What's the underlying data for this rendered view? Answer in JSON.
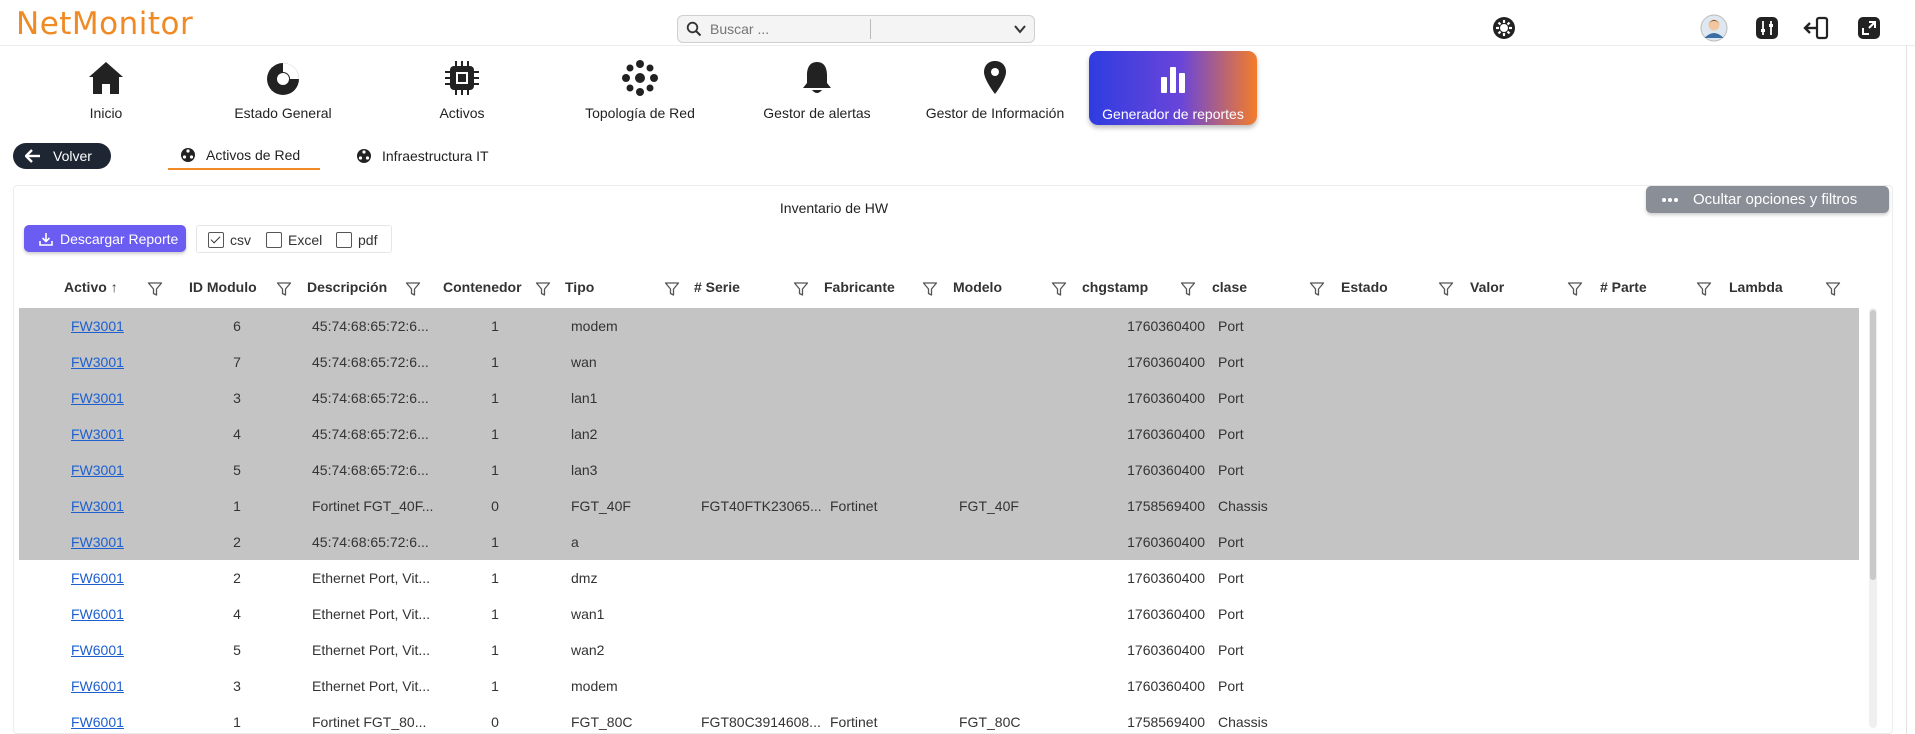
{
  "app": {
    "logo": "NetMonitor"
  },
  "search": {
    "placeholder": "Buscar ..."
  },
  "nav": [
    {
      "label": "Inicio",
      "icon": "home-icon"
    },
    {
      "label": "Estado General",
      "icon": "gauge-icon"
    },
    {
      "label": "Activos",
      "icon": "chip-icon"
    },
    {
      "label": "Topología de Red",
      "icon": "network-icon"
    },
    {
      "label": "Gestor de alertas",
      "icon": "bell-icon"
    },
    {
      "label": "Gestor de Información",
      "icon": "map-pin-icon"
    },
    {
      "label": "Generador de reportes",
      "icon": "bar-chart-icon",
      "active": true
    }
  ],
  "back": {
    "label": "Volver"
  },
  "subtabs": [
    {
      "label": "Activos de Red",
      "active": true
    },
    {
      "label": "Infraestructura IT",
      "active": false
    }
  ],
  "panel": {
    "title": "Inventario de HW",
    "toggle_label": "Ocultar opciones y filtros",
    "download_label": "Descargar Reporte",
    "formats": [
      {
        "label": "csv",
        "checked": true
      },
      {
        "label": "Excel",
        "checked": false
      },
      {
        "label": "pdf",
        "checked": false
      }
    ]
  },
  "table": {
    "columns": [
      "Activo",
      "ID Modulo",
      "Descripción",
      "Contenedor",
      "Tipo",
      "# Serie",
      "Fabricante",
      "Modelo",
      "chgstamp",
      "clase",
      "Estado",
      "Valor",
      "# Parte",
      "Lambda"
    ],
    "sort_indicator": "↑",
    "rows": [
      {
        "activo": "FW3001",
        "id": "6",
        "desc": "45:74:68:65:72:6...",
        "cont": "1",
        "tipo": "modem",
        "serie": "",
        "fab": "",
        "modelo": "",
        "chg": "1760360400",
        "clase": "Port",
        "selected": true
      },
      {
        "activo": "FW3001",
        "id": "7",
        "desc": "45:74:68:65:72:6...",
        "cont": "1",
        "tipo": "wan",
        "serie": "",
        "fab": "",
        "modelo": "",
        "chg": "1760360400",
        "clase": "Port",
        "selected": true
      },
      {
        "activo": "FW3001",
        "id": "3",
        "desc": "45:74:68:65:72:6...",
        "cont": "1",
        "tipo": "lan1",
        "serie": "",
        "fab": "",
        "modelo": "",
        "chg": "1760360400",
        "clase": "Port",
        "selected": true
      },
      {
        "activo": "FW3001",
        "id": "4",
        "desc": "45:74:68:65:72:6...",
        "cont": "1",
        "tipo": "lan2",
        "serie": "",
        "fab": "",
        "modelo": "",
        "chg": "1760360400",
        "clase": "Port",
        "selected": true
      },
      {
        "activo": "FW3001",
        "id": "5",
        "desc": "45:74:68:65:72:6...",
        "cont": "1",
        "tipo": "lan3",
        "serie": "",
        "fab": "",
        "modelo": "",
        "chg": "1760360400",
        "clase": "Port",
        "selected": true
      },
      {
        "activo": "FW3001",
        "id": "1",
        "desc": "Fortinet FGT_40F...",
        "cont": "0",
        "tipo": "FGT_40F",
        "serie": "FGT40FTK23065...",
        "fab": "Fortinet",
        "modelo": "FGT_40F",
        "chg": "1758569400",
        "clase": "Chassis",
        "selected": true
      },
      {
        "activo": "FW3001",
        "id": "2",
        "desc": "45:74:68:65:72:6...",
        "cont": "1",
        "tipo": "a",
        "serie": "",
        "fab": "",
        "modelo": "",
        "chg": "1760360400",
        "clase": "Port",
        "selected": true
      },
      {
        "activo": "FW6001",
        "id": "2",
        "desc": "Ethernet Port, Vit...",
        "cont": "1",
        "tipo": "dmz",
        "serie": "",
        "fab": "",
        "modelo": "",
        "chg": "1760360400",
        "clase": "Port",
        "selected": false
      },
      {
        "activo": "FW6001",
        "id": "4",
        "desc": "Ethernet Port, Vit...",
        "cont": "1",
        "tipo": "wan1",
        "serie": "",
        "fab": "",
        "modelo": "",
        "chg": "1760360400",
        "clase": "Port",
        "selected": false
      },
      {
        "activo": "FW6001",
        "id": "5",
        "desc": "Ethernet Port, Vit...",
        "cont": "1",
        "tipo": "wan2",
        "serie": "",
        "fab": "",
        "modelo": "",
        "chg": "1760360400",
        "clase": "Port",
        "selected": false
      },
      {
        "activo": "FW6001",
        "id": "3",
        "desc": "Ethernet Port, Vit...",
        "cont": "1",
        "tipo": "modem",
        "serie": "",
        "fab": "",
        "modelo": "",
        "chg": "1760360400",
        "clase": "Port",
        "selected": false
      },
      {
        "activo": "FW6001",
        "id": "1",
        "desc": "Fortinet FGT_80...",
        "cont": "0",
        "tipo": "FGT_80C",
        "serie": "FGT80C3914608...",
        "fab": "Fortinet",
        "modelo": "FGT_80C",
        "chg": "1758569400",
        "clase": "Chassis",
        "selected": false
      }
    ]
  },
  "colors": {
    "brand": "#f08a24",
    "selected_row": "#c4c4c4",
    "link": "#1d5fd0",
    "download": "#6b5cf2",
    "dark_button": "#1e2633"
  }
}
